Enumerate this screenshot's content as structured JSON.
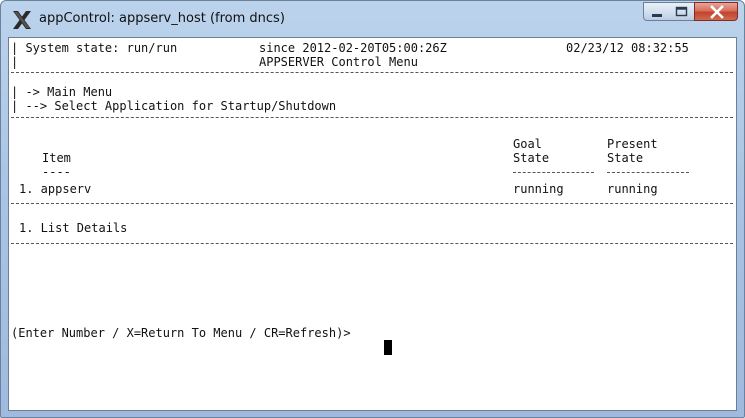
{
  "window": {
    "title": "appControl: appserv_host (from dncs)",
    "icon": "x-logo-icon",
    "controls": [
      "minimize-icon",
      "maximize-icon",
      "close-icon"
    ]
  },
  "terminal": {
    "status_state": "| System state: run/run",
    "status_since": "since 2012-02-20T05:00:26Z",
    "status_datetime": "02/23/12 08:32:55",
    "menu_title": "APPSERVER Control Menu",
    "pipe": "|",
    "breadcrumb_1": "| -> Main Menu",
    "breadcrumb_2": "| --> Select Application for Startup/Shutdown",
    "col_item": "Item",
    "col_item_underline": "----",
    "col_goal_line1": "Goal",
    "col_goal_line2": "State",
    "col_present_line1": "Present",
    "col_present_line2": "State",
    "rows": [
      {
        "item": "1. appserv",
        "goal": "running",
        "present": "running"
      }
    ],
    "option_1": "1. List Details",
    "prompt": "(Enter Number / X=Return To Menu / CR=Refresh)>"
  },
  "colors": {
    "titlebar": "#a9c4e4",
    "close_button": "#c3432e",
    "terminal_bg": "#ffffff",
    "terminal_text": "#111111"
  }
}
